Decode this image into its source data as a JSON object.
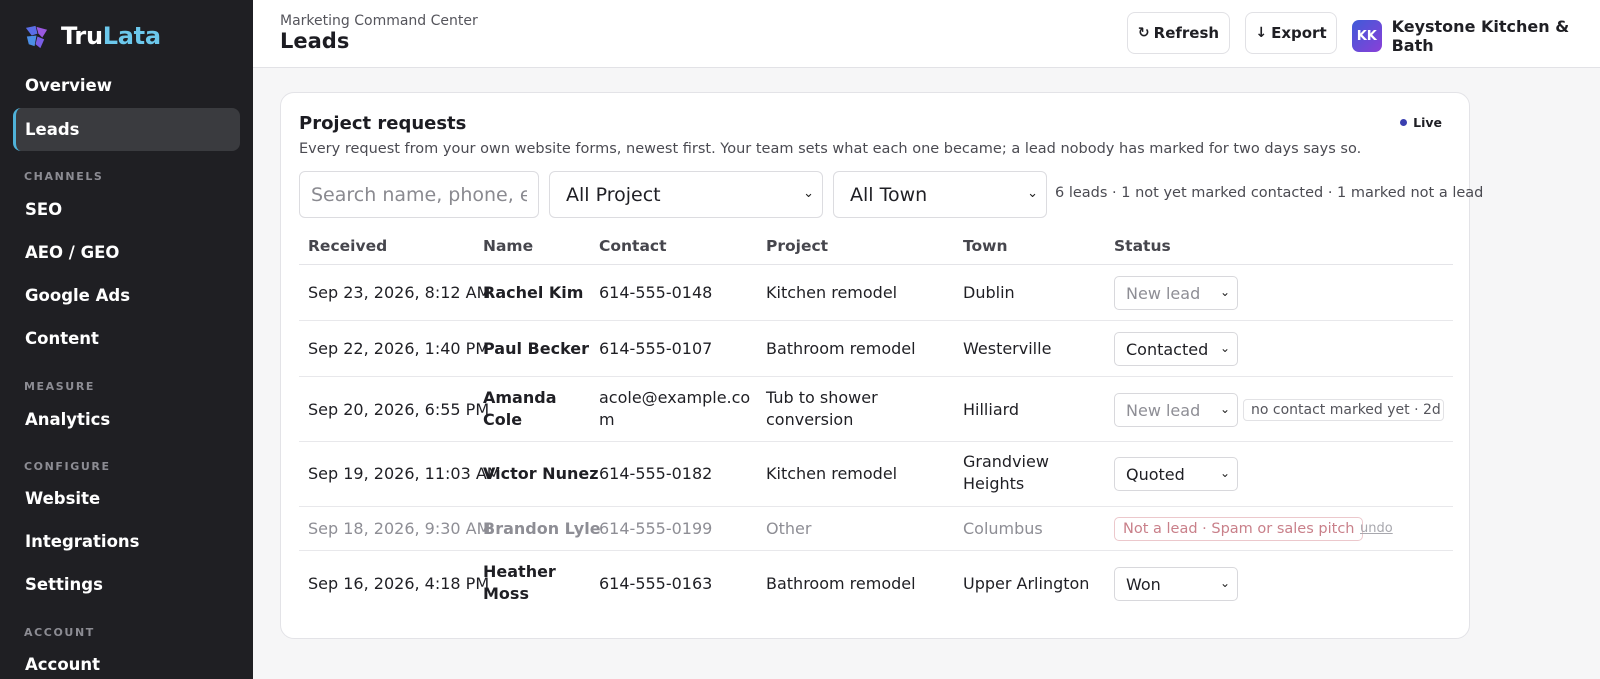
{
  "brand": {
    "part1": "Tru",
    "part2": "Lata"
  },
  "sidebar": {
    "items": [
      {
        "label": "Overview"
      },
      {
        "label": "Leads"
      },
      {
        "label": "SEO"
      },
      {
        "label": "AEO / GEO"
      },
      {
        "label": "Google Ads"
      },
      {
        "label": "Content"
      },
      {
        "label": "Analytics"
      },
      {
        "label": "Website"
      },
      {
        "label": "Integrations"
      },
      {
        "label": "Settings"
      },
      {
        "label": "Account"
      }
    ],
    "sections": [
      "CHANNELS",
      "MEASURE",
      "CONFIGURE",
      "ACCOUNT"
    ],
    "active": "Leads"
  },
  "header": {
    "breadcrumb": "Marketing Command Center",
    "title": "Leads",
    "refresh_label": "Refresh",
    "export_label": "Export",
    "account_initials": "KK",
    "account_name": "Keystone Kitchen & Bath"
  },
  "card": {
    "title": "Project requests",
    "subtitle": "Every request from your own website forms, newest first. Your team sets what each one became; a lead nobody has marked for two days says so.",
    "live_label": "Live",
    "search_placeholder": "Search name, phone, e",
    "project_filter": "All Project",
    "town_filter": "All Town",
    "summary": "6 leads · 1 not yet marked contacted · 1 marked not a lead"
  },
  "table": {
    "headers": {
      "received": "Received",
      "name": "Name",
      "contact": "Contact",
      "project": "Project",
      "town": "Town",
      "status": "Status"
    },
    "rows": [
      {
        "received": "Sep 23, 2026, 8:12 AM",
        "name": "Rachel Kim",
        "contact": "614-555-0148",
        "project": "Kitchen remodel",
        "town": "Dublin",
        "status": "New lead"
      },
      {
        "received": "Sep 22, 2026, 1:40 PM",
        "name": "Paul Becker",
        "contact": "614-555-0107",
        "project": "Bathroom remodel",
        "town": "Westerville",
        "status": "Contacted"
      },
      {
        "received": "Sep 20, 2026, 6:55 PM",
        "name_line1": "Amanda",
        "name_line2": "Cole",
        "contact_line1": "acole@example.co",
        "contact_line2": "m",
        "project_line1": "Tub to shower",
        "project_line2": "conversion",
        "town": "Hilliard",
        "status": "New lead",
        "flag": "no contact marked yet · 2d"
      },
      {
        "received": "Sep 19, 2026, 11:03 AM",
        "name": "Victor Nunez",
        "contact": "614-555-0182",
        "project": "Kitchen remodel",
        "town_line1": "Grandview",
        "town_line2": "Heights",
        "status": "Quoted"
      },
      {
        "received": "Sep 18, 2026, 9:30 AM",
        "name": "Brandon Lyle",
        "contact": "614-555-0199",
        "project": "Other",
        "town": "Columbus",
        "status": "Not a lead · Spam or sales pitch",
        "undo": "undo"
      },
      {
        "received": "Sep 16, 2026, 4:18 PM",
        "name_line1": "Heather",
        "name_line2": "Moss",
        "contact": "614-555-0163",
        "project": "Bathroom remodel",
        "town": "Upper Arlington",
        "status": "Won"
      }
    ]
  },
  "colors": {
    "sidebar_bg": "#1f1f23",
    "accent": "#4fb2d9",
    "brand_lata": "#6cc8ec",
    "live_dot": "#3a3fb0",
    "not_lead": "#c9808a"
  }
}
